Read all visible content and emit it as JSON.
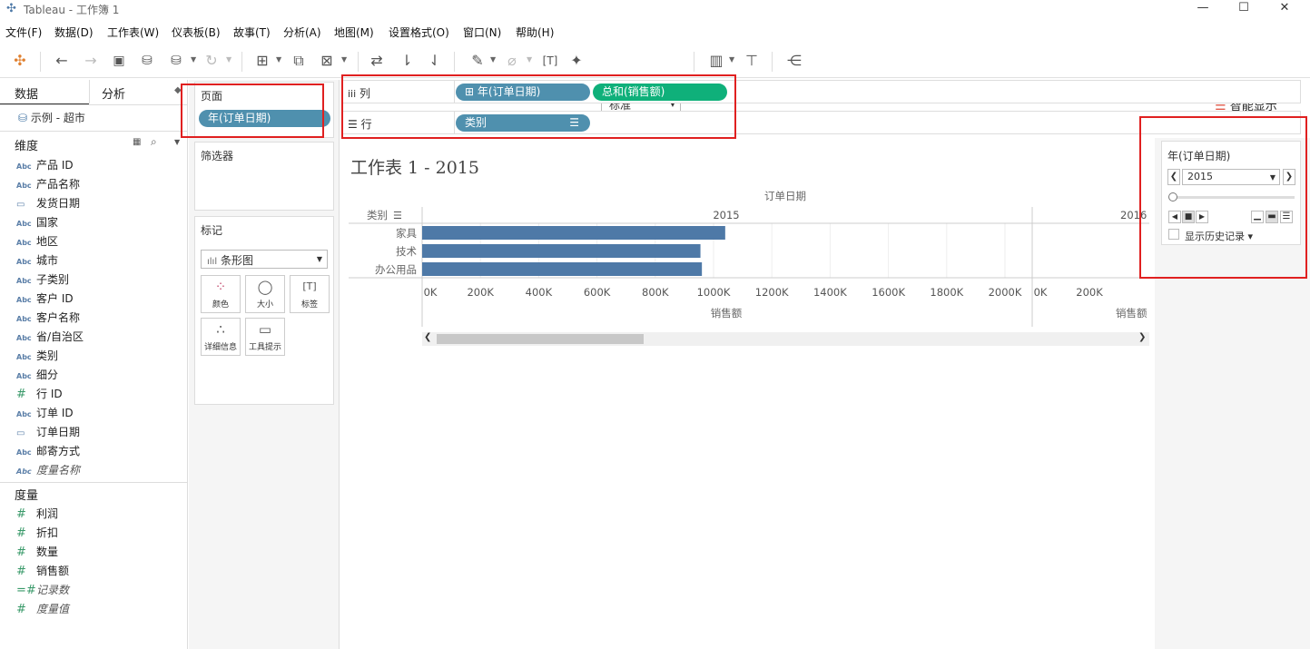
{
  "window": {
    "title": "Tableau - 工作簿 1",
    "min": "—",
    "max": "☐",
    "close": "✕"
  },
  "menu": [
    "文件(F)",
    "数据(D)",
    "工作表(W)",
    "仪表板(B)",
    "故事(T)",
    "分析(A)",
    "地图(M)",
    "设置格式(O)",
    "窗口(N)",
    "帮助(H)"
  ],
  "toolbar": {
    "fit_select": "标准",
    "smart_show": "智能显示"
  },
  "left_panel": {
    "tabs": [
      "数据",
      "分析"
    ],
    "datasource": "示例 - 超市",
    "dimensions_header": "维度",
    "dimensions": [
      {
        "icon": "Abc",
        "name": "产品 ID"
      },
      {
        "icon": "Abc",
        "name": "产品名称"
      },
      {
        "icon": "cal",
        "name": "发货日期"
      },
      {
        "icon": "Abc",
        "name": "国家"
      },
      {
        "icon": "Abc",
        "name": "地区"
      },
      {
        "icon": "Abc",
        "name": "城市"
      },
      {
        "icon": "Abc",
        "name": "子类别"
      },
      {
        "icon": "Abc",
        "name": "客户 ID"
      },
      {
        "icon": "Abc",
        "name": "客户名称"
      },
      {
        "icon": "Abc",
        "name": "省/自治区"
      },
      {
        "icon": "Abc",
        "name": "类别"
      },
      {
        "icon": "Abc",
        "name": "细分"
      },
      {
        "icon": "#",
        "name": "行 ID"
      },
      {
        "icon": "Abc",
        "name": "订单 ID"
      },
      {
        "icon": "cal",
        "name": "订单日期"
      },
      {
        "icon": "Abc",
        "name": "邮寄方式"
      },
      {
        "icon": "Abc",
        "name": "度量名称",
        "italic": true
      }
    ],
    "measures_header": "度量",
    "measures": [
      {
        "icon": "#",
        "name": "利润"
      },
      {
        "icon": "#",
        "name": "折扣"
      },
      {
        "icon": "#",
        "name": "数量"
      },
      {
        "icon": "#",
        "name": "销售额"
      },
      {
        "icon": "=#",
        "name": "记录数",
        "italic": true
      },
      {
        "icon": "#",
        "name": "度量值",
        "italic": true
      }
    ]
  },
  "pages_card": {
    "title": "页面",
    "pill": "年(订单日期)"
  },
  "filters_card": {
    "title": "筛选器"
  },
  "marks_card": {
    "title": "标记",
    "mark_type": "条形图",
    "buttons": [
      "颜色",
      "大小",
      "标签",
      "详细信息",
      "工具提示"
    ]
  },
  "shelves": {
    "columns_label": "列",
    "columns_pills": [
      "年(订单日期)",
      "总和(销售额)"
    ],
    "rows_label": "行",
    "rows_pills": [
      "类别"
    ]
  },
  "sheet": {
    "title": "工作表 1 - 2015"
  },
  "chart_data": {
    "type": "bar",
    "orientation": "horizontal",
    "header": "订单日期",
    "row_header": "类别",
    "panes": [
      "2015",
      "2016"
    ],
    "categories": [
      "家具",
      "技术",
      "办公用品"
    ],
    "series": [
      {
        "name": "2015",
        "values": [
          1040000,
          955000,
          960000
        ]
      }
    ],
    "xlabel": "销售额",
    "xticks": [
      "0K",
      "200K",
      "400K",
      "600K",
      "800K",
      "1000K",
      "1200K",
      "1400K",
      "1600K",
      "1800K",
      "2000K"
    ],
    "xticks_pane2": [
      "0K",
      "200K"
    ],
    "xlim": [
      0,
      2100000
    ],
    "bar_color": "#4e79a7"
  },
  "page_control": {
    "title": "年(订单日期)",
    "value": "2015",
    "show_history": "显示历史记录"
  }
}
